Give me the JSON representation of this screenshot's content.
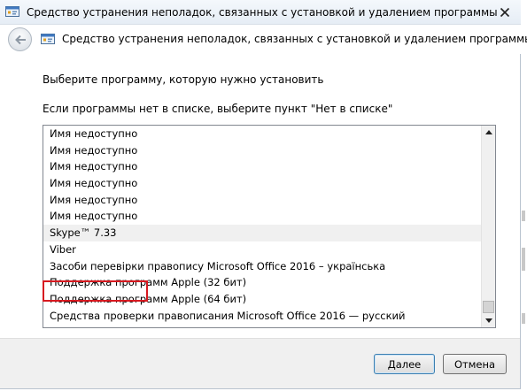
{
  "window": {
    "title": "Средство устранения неполадок, связанных с установкой и удалением программы"
  },
  "nav": {
    "title": "Средство устранения неполадок, связанных с установкой и удалением программы"
  },
  "main": {
    "prompt": "Выберите программу, которую нужно установить",
    "hint": "Если программы нет в списке, выберите пункт \"Нет в списке\"",
    "programs": [
      "Имя недоступно",
      "Имя недоступно",
      "Имя недоступно",
      "Имя недоступно",
      "Имя недоступно",
      "Имя недоступно",
      "Skype™ 7.33",
      "Viber",
      "Засоби перевірки правопису Microsoft Office 2016 – українська",
      "Поддержка программ Apple (32 бит)",
      "Поддержка программ Apple (64 бит)",
      "Средства проверки правописания Microsoft Office 2016 — русский"
    ],
    "highlighted_index": 6,
    "annotation_color": "#d71920"
  },
  "footer": {
    "next_label": "Далее",
    "cancel_label": "Отмена"
  },
  "icons": {
    "title_icon": "troubleshooter-icon",
    "close": "close-icon",
    "back": "back-arrow-icon"
  }
}
